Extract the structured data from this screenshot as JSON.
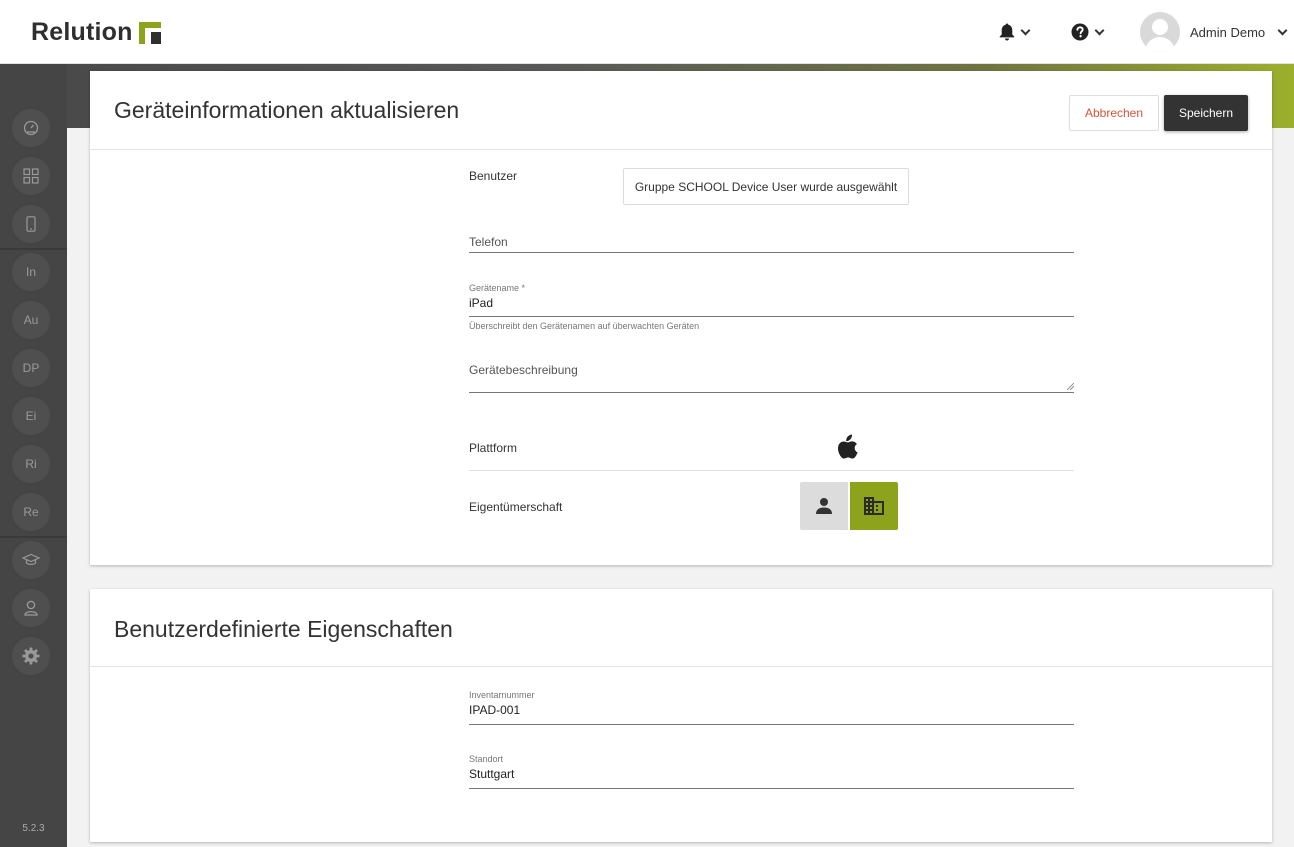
{
  "header": {
    "logo_text": "Relution",
    "user_name": "Admin Demo"
  },
  "sidebar": {
    "version": "5.2.3",
    "letter_items": [
      "In",
      "Au",
      "DP",
      "Ei",
      "Ri",
      "Re"
    ]
  },
  "device_card": {
    "title": "Geräteinformationen aktualisieren",
    "cancel_label": "Abbrechen",
    "save_label": "Speichern",
    "user_label": "Benutzer",
    "user_value": "Gruppe SCHOOL Device User wurde ausgewählt",
    "phone_placeholder": "Telefon",
    "device_name_label": "Gerätename *",
    "device_name_value": "iPad",
    "device_name_hint": "Überschreibt den Gerätenamen auf überwachten Geräten",
    "description_placeholder": "Gerätebeschreibung",
    "platform_label": "Plattform",
    "ownership_label": "Eigentümerschaft"
  },
  "custom_card": {
    "title": "Benutzerdefinierte Eigenschaften",
    "inventory_label": "Inventarnummer",
    "inventory_value": "IPAD-001",
    "location_label": "Standort",
    "location_value": "Stuttgart"
  },
  "colors": {
    "accent": "#8ca31b",
    "sidebar_bg": "#454545",
    "cancel_text": "#d6533a",
    "save_bg": "#333333"
  },
  "icons": {
    "notification": "bell-icon",
    "help": "question-circle-icon",
    "platform": "apple-icon",
    "ownership_personal": "person-icon",
    "ownership_company": "building-icon"
  }
}
